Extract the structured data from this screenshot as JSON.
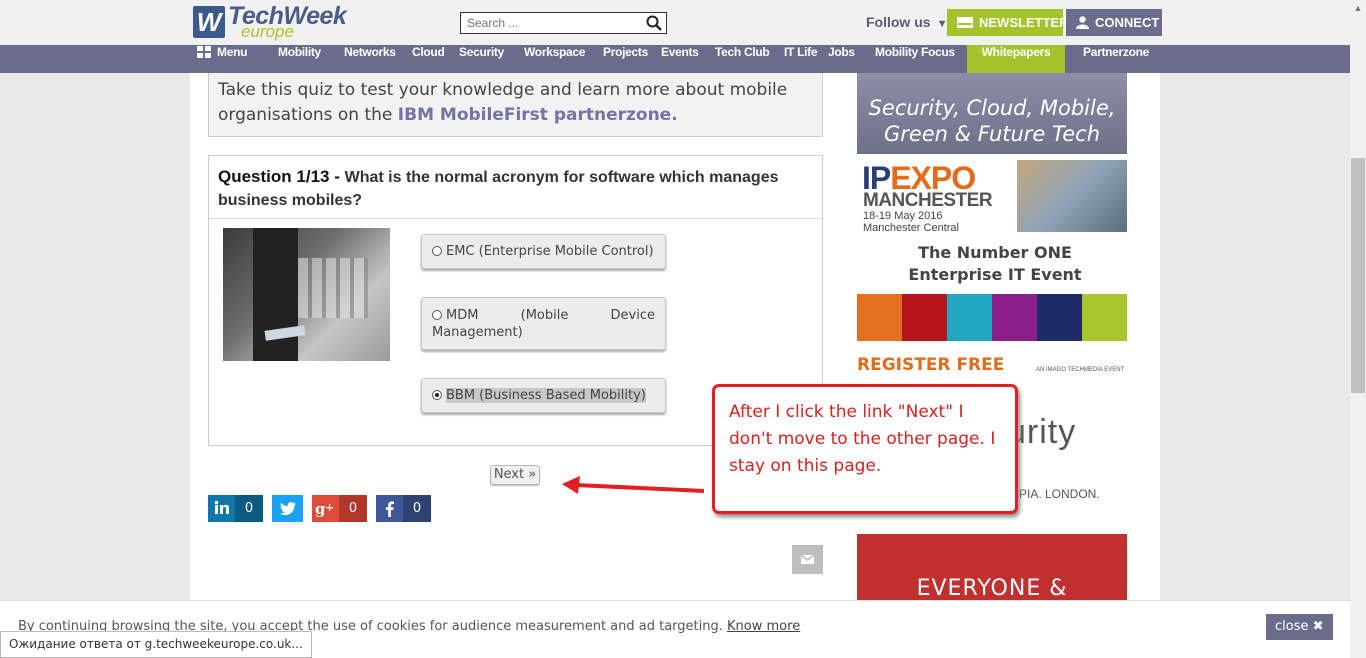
{
  "header": {
    "logo_main": "TechWeek",
    "logo_sub": "europe",
    "search_placeholder": "Search ...",
    "follow_label": "Follow us",
    "newsletter_label": "NEWSLETTER",
    "connect_label": "CONNECT"
  },
  "nav": {
    "items": [
      {
        "label": "Menu"
      },
      {
        "label": "Mobility"
      },
      {
        "label": "Networks"
      },
      {
        "label": "Cloud"
      },
      {
        "label": "Security"
      },
      {
        "label": "Workspace"
      },
      {
        "label": "Projects"
      },
      {
        "label": "Events"
      },
      {
        "label": "Tech Club"
      },
      {
        "label": "IT Life"
      },
      {
        "label": "Jobs"
      },
      {
        "label": "Mobility Focus"
      },
      {
        "label": "Whitepapers"
      },
      {
        "label": "Partnerzone"
      }
    ],
    "active": "Whitepapers"
  },
  "intro": {
    "text": "Take this quiz to test your knowledge and learn more about mobile organisations on the ",
    "link": "IBM MobileFirst partnerzone."
  },
  "quiz": {
    "number": "Question 1/13 -",
    "question": "What is the normal acronym for software which manages business mobiles?",
    "answers": [
      {
        "label": "EMC (Enterprise Mobile Control)",
        "selected": false
      },
      {
        "label": "MDM (Mobile Device Management)",
        "selected": false
      },
      {
        "label": "BBM (Business Based Mobility)",
        "selected": true
      }
    ],
    "next_label": "Next »"
  },
  "share": {
    "linkedin_count": "0",
    "googleplus_count": "0",
    "facebook_count": "0"
  },
  "sidebar": {
    "ad1_line1": "Security, Cloud, Mobile,",
    "ad1_line2": "Green & Future Tech",
    "ipexpo_ip": "IP",
    "ipexpo_expo": "EXPO",
    "ipexpo_city": "MANCHESTER",
    "ipexpo_dates": "18-19 May 2016",
    "ipexpo_venue": "Manchester Central",
    "number_one_line1": "The Number ONE",
    "number_one_line2": "Enterprise IT Event",
    "register": "REGISTER FREE",
    "register_small": "AN IMAGO TECHMEDIA EVENT",
    "ad3_big": "urity",
    "ad3_small": "MPIA. LONDON.",
    "ad4_text": "EVERYONE &",
    "bar_colors": [
      "#e5701f",
      "#b5161d",
      "#21a5c0",
      "#8c1f8a",
      "#1d2c67",
      "#a9c62c"
    ]
  },
  "annotation": {
    "text": "After I click the link \"Next\" I don't move to the other page. I stay on this page."
  },
  "cookie": {
    "text": "By continuing browsing the site, you accept the use of cookies for audience measurement and ad targeting.",
    "link": "Know more",
    "close_label": "close ✖"
  },
  "status_bar": {
    "text": "Ожидание ответа от g.techweekeurope.co.uk..."
  }
}
